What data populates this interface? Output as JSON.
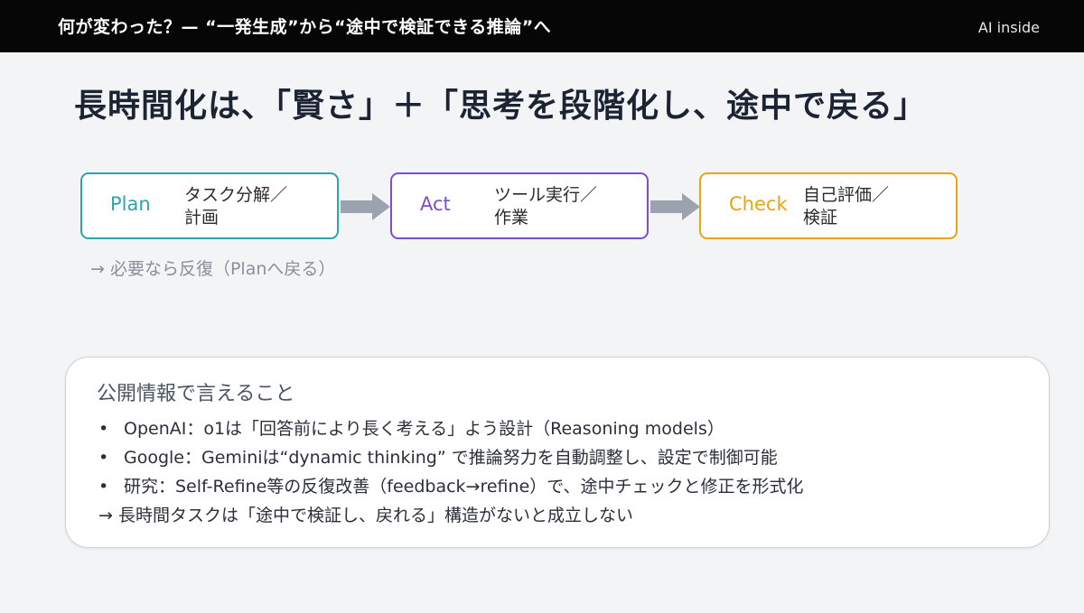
{
  "header": {
    "title": "何が変わった？— “一発生成”から“途中で検証できる推論”へ",
    "brand": "AI inside"
  },
  "main_title": "長時間化は、「賢さ」＋「思考を段階化し、途中で戻る」",
  "flow": {
    "steps": [
      {
        "label": "Plan",
        "desc": "タスク分解／\n計画",
        "color": "#2aa4b0"
      },
      {
        "label": "Act",
        "desc": "ツール実行／\n作業",
        "color": "#7b4fc9"
      },
      {
        "label": "Check",
        "desc": "自己評価／\n検証",
        "color": "#e8a317"
      }
    ],
    "arrow_color": "#9ca3af",
    "loop_note": "→ 必要なら反復（Planへ戻る）"
  },
  "info": {
    "heading": "公開情報で言えること",
    "bullet_symbol": "•",
    "items": [
      "OpenAI：o1は「回答前により長く考える」よう設計（Reasoning models）",
      "Google：Geminiは“dynamic thinking” で推論努力を自動調整し、設定で制御可能",
      "研究：Self-Refine等の反復改善（feedback→refine）で、途中チェックと修正を形式化"
    ],
    "conclusion": "→ 長時間タスクは「途中で検証し、戻れる」構造がないと成立しない"
  }
}
